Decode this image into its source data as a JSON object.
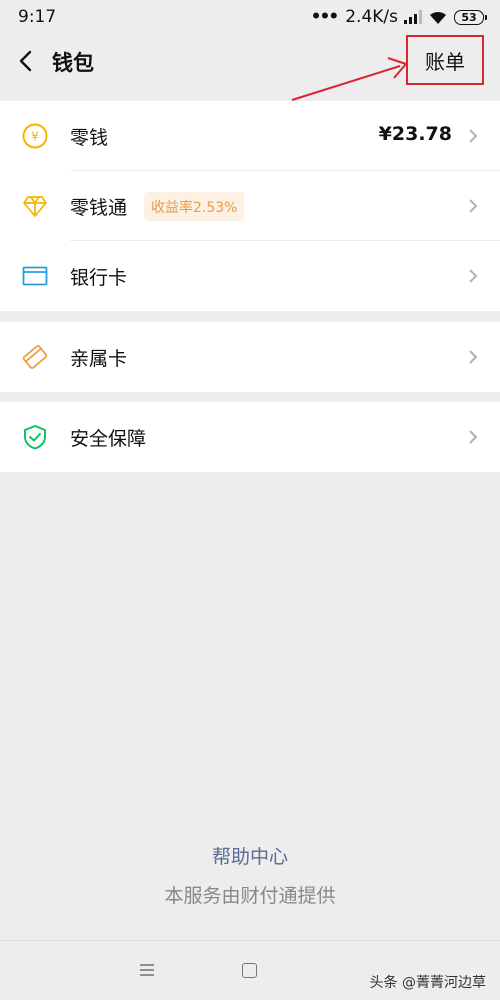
{
  "status_bar": {
    "time": "9:17",
    "net_speed": "2.4K/s",
    "battery": "53"
  },
  "nav": {
    "title": "钱包",
    "action_label": "账单"
  },
  "wallet_items": [
    {
      "label": "零钱",
      "value": "¥23.78",
      "icon": "coin-icon"
    },
    {
      "label": "零钱通",
      "badge": "收益率2.53%",
      "icon": "diamond-icon"
    },
    {
      "label": "银行卡",
      "icon": "bank-card-icon"
    }
  ],
  "family_items": [
    {
      "label": "亲属卡",
      "icon": "family-card-icon"
    }
  ],
  "security_items": [
    {
      "label": "安全保障",
      "icon": "shield-icon"
    }
  ],
  "footer": {
    "help_link": "帮助中心",
    "provider_text": "本服务由财付通提供"
  },
  "watermark": {
    "text": "头条 @菁菁河边草"
  },
  "colors": {
    "accent_link": "#576b95",
    "highlight_border": "#d9262f",
    "coin": "#f4b400",
    "bank": "#2b9be0",
    "family": "#f0a040",
    "shield": "#07c160"
  }
}
